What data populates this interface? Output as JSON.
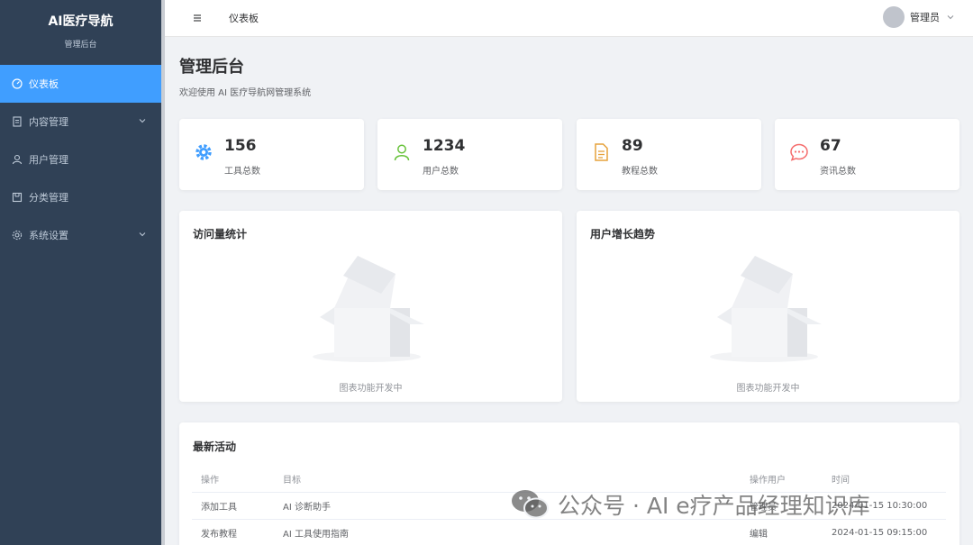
{
  "sidebar": {
    "brand_title": "AI医疗导航",
    "brand_subtitle": "管理后台",
    "items": [
      {
        "label": "仪表板",
        "icon": "gauge-icon",
        "active": true
      },
      {
        "label": "内容管理",
        "icon": "document-icon",
        "has_submenu": true
      },
      {
        "label": "用户管理",
        "icon": "user-icon"
      },
      {
        "label": "分类管理",
        "icon": "folder-icon"
      },
      {
        "label": "系统设置",
        "icon": "gear-icon",
        "has_submenu": true
      }
    ]
  },
  "header": {
    "breadcrumb": "仪表板",
    "user_name": "管理员"
  },
  "main": {
    "title": "管理后台",
    "subtitle": "欢迎使用 AI 医疗导航网管理系统",
    "stats": [
      {
        "value": "156",
        "label": "工具总数",
        "icon": "gear-icon",
        "color": "#409eff"
      },
      {
        "value": "1234",
        "label": "用户总数",
        "icon": "user-icon",
        "color": "#67c23a"
      },
      {
        "value": "89",
        "label": "教程总数",
        "icon": "document-icon",
        "color": "#e6a23c"
      },
      {
        "value": "67",
        "label": "资讯总数",
        "icon": "chat-icon",
        "color": "#f56c6c"
      }
    ],
    "charts": [
      {
        "title": "访问量统计",
        "empty_text": "图表功能开发中"
      },
      {
        "title": "用户增长趋势",
        "empty_text": "图表功能开发中"
      }
    ],
    "activity": {
      "title": "最新活动",
      "columns": [
        "操作",
        "目标",
        "操作用户",
        "时间"
      ],
      "rows": [
        [
          "添加工具",
          "AI 诊断助手",
          "管理员",
          "2024-01-15 10:30:00"
        ],
        [
          "发布教程",
          "AI 工具使用指南",
          "编辑",
          "2024-01-15 09:15:00"
        ]
      ]
    }
  },
  "watermark": "公众号 · AI e疗产品经理知识库"
}
